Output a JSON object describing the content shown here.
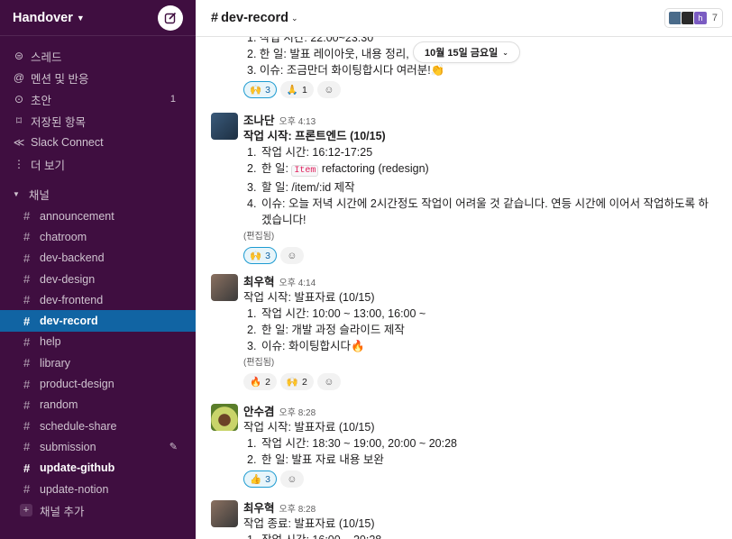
{
  "workspace": {
    "name": "Handover"
  },
  "nav": [
    {
      "icon": "threads-icon",
      "glyph": "⊜",
      "label": "스레드"
    },
    {
      "icon": "mentions-icon",
      "glyph": "@",
      "label": "멘션 및 반응"
    },
    {
      "icon": "drafts-icon",
      "glyph": "⊙",
      "label": "초안",
      "count": "1"
    },
    {
      "icon": "bookmark-icon",
      "glyph": "⌑",
      "label": "저장된 항목"
    },
    {
      "icon": "slack-connect-icon",
      "glyph": "≪",
      "label": "Slack Connect"
    },
    {
      "icon": "more-icon",
      "glyph": "⋮",
      "label": "더 보기"
    }
  ],
  "channels_section": {
    "label": "채널"
  },
  "channels": [
    {
      "name": "announcement",
      "state": ""
    },
    {
      "name": "chatroom",
      "state": ""
    },
    {
      "name": "dev-backend",
      "state": ""
    },
    {
      "name": "dev-design",
      "state": ""
    },
    {
      "name": "dev-frontend",
      "state": ""
    },
    {
      "name": "dev-record",
      "state": "active"
    },
    {
      "name": "help",
      "state": ""
    },
    {
      "name": "library",
      "state": ""
    },
    {
      "name": "product-design",
      "state": ""
    },
    {
      "name": "random",
      "state": ""
    },
    {
      "name": "schedule-share",
      "state": ""
    },
    {
      "name": "submission",
      "state": "draft"
    },
    {
      "name": "update-github",
      "state": "bold"
    },
    {
      "name": "update-notion",
      "state": ""
    }
  ],
  "add_channel": "채널 추가",
  "channel_header": {
    "title": "dev-record",
    "member_count": "7",
    "member_initial": "h"
  },
  "date_divider": "10월 15일 금요일",
  "top_partial": {
    "lines": [
      "1.  작업 시간: 22:00~23:30",
      "2.  한 일: 발표 레이아웃, 내용 정리,",
      "3.  이슈: 조금만더 화이팅합시다 여러분!👏"
    ],
    "reactions": [
      {
        "emoji": "🙌",
        "count": "3",
        "mine": true
      },
      {
        "emoji": "🙏",
        "count": "1",
        "mine": false
      }
    ]
  },
  "messages": [
    {
      "sender": "조나단",
      "time": "오후 4:13",
      "title": "작업 시작: 프론트엔드 (10/15)",
      "title_bold": true,
      "items": [
        {
          "n": "1.",
          "text": "작업 시간: 16:12-17:25"
        },
        {
          "n": "2.",
          "text_before": "한 일: ",
          "code": "Item",
          "text_after": " refactoring (redesign)"
        },
        {
          "n": "3.",
          "text": "할 일: /item/:id 제작"
        },
        {
          "n": "4.",
          "text": "이슈: 오늘 저녁 시간에 2시간정도 작업이 어려울 것 같습니다. 연등 시간에 이어서 작업하도록 하",
          "cont": "겠습니다!"
        }
      ],
      "edited": "(편집됨)",
      "reactions": [
        {
          "emoji": "🙌",
          "count": "3",
          "mine": true
        }
      ]
    },
    {
      "sender": "최우혁",
      "time": "오후 4:14",
      "title": "작업 시작: 발표자료 (10/15)",
      "title_bold": false,
      "items": [
        {
          "n": "1.",
          "text": "작업 시간: 10:00 ~ 13:00, 16:00 ~"
        },
        {
          "n": "2.",
          "text": "한 일: 개발 과정 슬라이드 제작"
        },
        {
          "n": "3.",
          "text": "이슈: 화이팅합시다🔥"
        }
      ],
      "edited": "(편집됨)",
      "reactions": [
        {
          "emoji": "🔥",
          "count": "2",
          "mine": false
        },
        {
          "emoji": "🙌",
          "count": "2",
          "mine": false
        }
      ]
    },
    {
      "sender": "안수겸",
      "time": "오후 8:28",
      "title": "작업 시작: 발표자료 (10/15)",
      "title_bold": false,
      "items": [
        {
          "n": "1.",
          "text": "작업 시간: 18:30 ~ 19:00, 20:00 ~ 20:28"
        },
        {
          "n": "2.",
          "text": "한 일: 발표 자료 내용 보완"
        }
      ],
      "reactions": [
        {
          "emoji": "👍",
          "count": "3",
          "mine": true
        }
      ]
    },
    {
      "sender": "최우혁",
      "time": "오후 8:28",
      "title": "작업 종료: 발표자료 (10/15)",
      "title_bold": false,
      "items": [
        {
          "n": "1.",
          "text": "작업 시간: 16:00 ~ 20:28"
        }
      ]
    }
  ],
  "colors": {
    "sidebar": "#3f0e40",
    "active": "#1164a3",
    "reaction_mine": "#1d9bd1"
  }
}
